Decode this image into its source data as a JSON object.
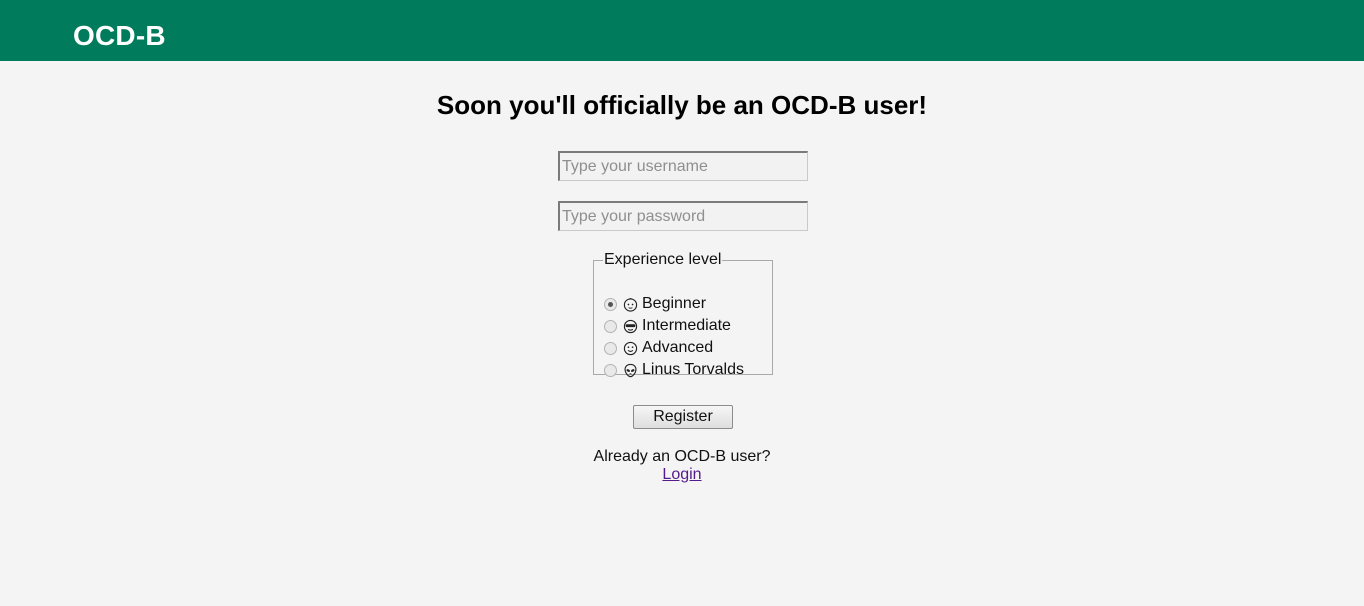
{
  "header": {
    "brand": "OCD-B"
  },
  "main": {
    "heading": "Soon you'll officially be an OCD-B user!",
    "username": {
      "placeholder": "Type your username",
      "value": ""
    },
    "password": {
      "placeholder": "Type your password",
      "value": ""
    },
    "experience": {
      "legend": "Experience level",
      "selected": "Beginner",
      "options": [
        {
          "label": "Beginner",
          "icon": "baby-face-icon"
        },
        {
          "label": "Intermediate",
          "icon": "sunglasses-face-icon"
        },
        {
          "label": "Advanced",
          "icon": "smiling-face-icon"
        },
        {
          "label": "Linus Torvalds",
          "icon": "alien-face-icon"
        }
      ]
    },
    "register_label": "Register",
    "already_text": "Already an OCD-B user?",
    "login_label": "Login"
  },
  "colors": {
    "header_bg": "#007b5b",
    "page_bg": "#f4f4f4",
    "link": "#551a8b"
  }
}
